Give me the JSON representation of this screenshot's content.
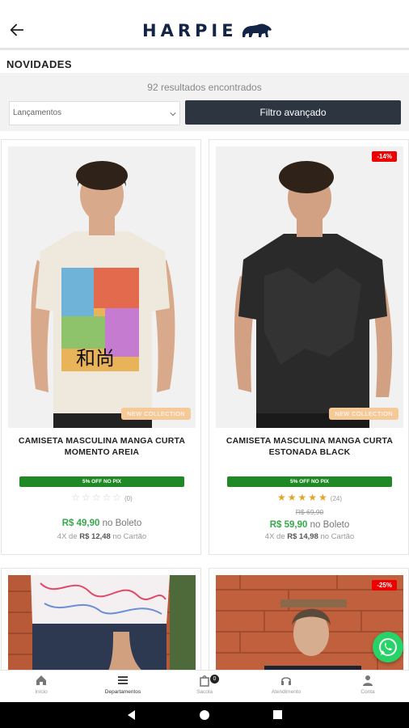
{
  "header": {
    "brand": "HARPIE",
    "back_icon": "arrow-left-icon",
    "logo_icon": "bear-icon"
  },
  "page": {
    "section_title": "NOVIDADES"
  },
  "filters": {
    "results_text": "92 resultados encontrados",
    "sort_value": "Lançamentos",
    "filter_button": "Filtro avançado"
  },
  "products": [
    {
      "title": "CAMISETA MASCULINA MANGA CURTA MOMENTO AREIA",
      "tag": "NEW COLLECTION",
      "pix_label": "5% OFF NO PIX",
      "rating": 0,
      "reviews": "(0)",
      "price": "R$ 49,90",
      "price_suffix": "no Boleto",
      "inst_prefix": "4X de",
      "inst_value": "R$ 12,48",
      "inst_suffix": "no Cartão"
    },
    {
      "title": "CAMISETA MASCULINA MANGA CURTA ESTONADA BLACK",
      "tag": "NEW COLLECTION",
      "badge": "-14%",
      "pix_label": "5% OFF NO PIX",
      "rating": 5,
      "reviews": "(24)",
      "old_price": "R$ 69,90",
      "price": "R$ 59,90",
      "price_suffix": "no Boleto",
      "inst_prefix": "4X de",
      "inst_value": "R$ 14,98",
      "inst_suffix": "no Cartão"
    },
    {},
    {
      "badge": "-25%"
    }
  ],
  "nav": {
    "items": [
      {
        "label": "Início",
        "icon": "home-icon"
      },
      {
        "label": "Departamentos",
        "icon": "list-icon"
      },
      {
        "label": "Sacola",
        "icon": "bag-icon",
        "badge": "0"
      },
      {
        "label": "Atendimento",
        "icon": "headset-icon"
      },
      {
        "label": "Conta",
        "icon": "user-icon"
      }
    ]
  },
  "colors": {
    "brand": "#142446",
    "filter_button": "#2c3540",
    "pix_green": "#1f8a25",
    "price_green": "#36a94b",
    "discount_red": "#ee0000",
    "star": "#e4a42a",
    "whatsapp": "#25d366"
  }
}
